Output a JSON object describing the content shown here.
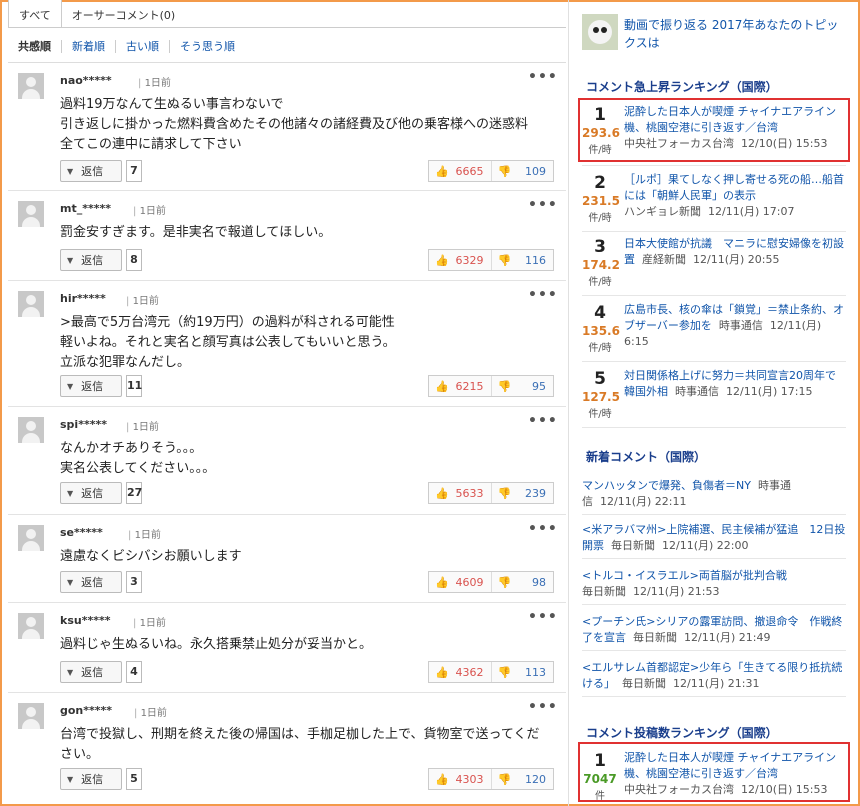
{
  "tabs": [
    "すべて",
    "オーサーコメント(0)"
  ],
  "sort": [
    "共感順",
    "新着順",
    "古い順",
    "そう思う順"
  ],
  "reply_label": "返信",
  "comments": [
    {
      "user": "nao*****",
      "time": "1日前",
      "text": "過料19万なんて生ぬるい事言わないで\n引き返しに掛かった燃料費含めたその他諸々の諸経費及び他の乗客様への迷惑料\n全てこの連中に請求して下さい",
      "replies": "7",
      "up": "6665",
      "down": "109"
    },
    {
      "user": "mt_*****",
      "time": "1日前",
      "text": "罰金安すぎます。是非実名で報道してほしい。",
      "replies": "8",
      "up": "6329",
      "down": "116"
    },
    {
      "user": "hir*****",
      "time": "1日前",
      "text": ">最高で5万台湾元（約19万円）の過料が科される可能性\n軽いよね。それと実名と顔写真は公表してもいいと思う。\n立派な犯罪なんだし。",
      "replies": "11",
      "up": "6215",
      "down": "95"
    },
    {
      "user": "spi*****",
      "time": "1日前",
      "text": "なんかオチありそう。。。\n実名公表してください。。。",
      "replies": "27",
      "up": "5633",
      "down": "239"
    },
    {
      "user": "se*****",
      "time": "1日前",
      "text": "遠慮なくビシバシお願いします",
      "replies": "3",
      "up": "4609",
      "down": "98"
    },
    {
      "user": "ksu*****",
      "time": "1日前",
      "text": "過料じゃ生ぬるいね。永久搭乗禁止処分が妥当かと。",
      "replies": "4",
      "up": "4362",
      "down": "113"
    },
    {
      "user": "gon*****",
      "time": "1日前",
      "text": "台湾で投獄し、刑期を終えた後の帰国は、手枷足枷した上で、貨物室で送ってください。",
      "replies": "5",
      "up": "4303",
      "down": "120"
    }
  ],
  "topic": {
    "title": "動画で振り返る 2017年あなたのトピックスは"
  },
  "ranking_rise": {
    "heading": "コメント急上昇ランキング（国際）",
    "unit": "件/時",
    "items": [
      {
        "rank": "1",
        "score": "293.6",
        "title": "泥酔した日本人が喫煙 チャイナエアライン機、桃園空港に引き返す／台湾",
        "source": "中央社フォーカス台湾",
        "date": "12/10(日) 15:53"
      },
      {
        "rank": "2",
        "score": "231.5",
        "title": "［ルポ］果てしなく押し寄せる死の船…船首には「朝鮮人民軍」の表示",
        "source": "ハンギョレ新聞",
        "date": "12/11(月) 17:07"
      },
      {
        "rank": "3",
        "score": "174.2",
        "title": "日本大使館が抗議　マニラに慰安婦像を初設置",
        "source": "産経新聞",
        "date": "12/11(月) 20:55"
      },
      {
        "rank": "4",
        "score": "135.6",
        "title": "広島市長、核の傘は「鎖覚」＝禁止条約、オブザーバー参加を",
        "source": "時事通信",
        "date": "12/11(月) 6:15"
      },
      {
        "rank": "5",
        "score": "127.5",
        "title": "対日関係格上げに努力＝共同宣言20周年で韓国外相",
        "source": "時事通信",
        "date": "12/11(月) 17:15"
      }
    ]
  },
  "new_comments": {
    "heading": "新着コメント（国際）",
    "items": [
      {
        "title": "マンハッタンで爆発、負傷者＝NY",
        "source": "時事通信",
        "date": "12/11(月) 22:11"
      },
      {
        "title": "<米アラバマ州>上院補選、民主候補が猛追　12日投開票",
        "source": "毎日新聞",
        "date": "12/11(月) 22:00"
      },
      {
        "title": "<トルコ・イスラエル>両首脳が批判合戦",
        "source": "毎日新聞",
        "date": "12/11(月) 21:53"
      },
      {
        "title": "<プーチン氏>シリアの露軍訪問、撤退命令　作戦終了を宣言",
        "source": "毎日新聞",
        "date": "12/11(月) 21:49"
      },
      {
        "title": "<エルサレム首都認定>少年ら「生きてる限り抵抗続ける」",
        "source": "毎日新聞",
        "date": "12/11(月) 21:31"
      }
    ]
  },
  "ranking_posts": {
    "heading": "コメント投稿数ランキング（国際）",
    "unit": "件",
    "items": [
      {
        "rank": "1",
        "score": "7047",
        "title": "泥酔した日本人が喫煙 チャイナエアライン機、桃園空港に引き返す／台湾",
        "source": "中央社フォーカス台湾",
        "date": "12/10(日) 15:53"
      }
    ]
  }
}
